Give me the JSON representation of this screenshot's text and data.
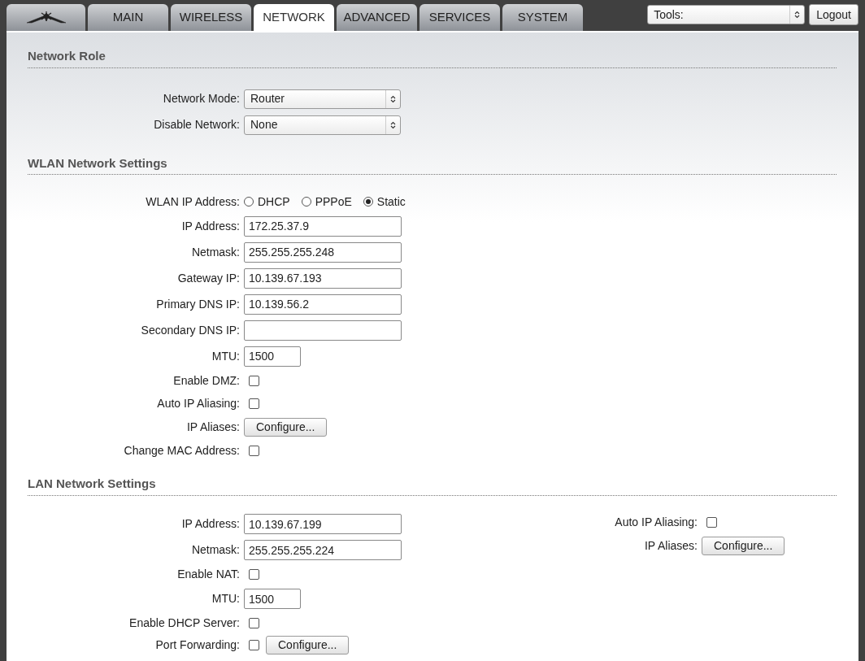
{
  "tabs": [
    {
      "kind": "logo",
      "selected": false
    },
    {
      "kind": "text",
      "label": "MAIN",
      "selected": false
    },
    {
      "kind": "text",
      "label": "WIRELESS",
      "selected": false
    },
    {
      "kind": "text",
      "label": "NETWORK",
      "selected": true
    },
    {
      "kind": "text",
      "label": "ADVANCED",
      "selected": false
    },
    {
      "kind": "text",
      "label": "SERVICES",
      "selected": false
    },
    {
      "kind": "text",
      "label": "SYSTEM",
      "selected": false
    }
  ],
  "tools_select": {
    "value": "Tools:"
  },
  "logout_button": "Logout",
  "sections": [
    {
      "title": "Network Role",
      "rows": [
        {
          "kind": "select",
          "label": "Network Mode:",
          "value": "Router"
        },
        {
          "kind": "select",
          "label": "Disable Network:",
          "value": "None"
        }
      ]
    },
    {
      "title": "WLAN Network Settings",
      "rows": [
        {
          "kind": "radio",
          "label": "WLAN IP Address:",
          "options": [
            {
              "label": "DHCP",
              "selected": false
            },
            {
              "label": "PPPoE",
              "selected": false
            },
            {
              "label": "Static",
              "selected": true
            }
          ]
        },
        {
          "kind": "text",
          "label": "IP Address:",
          "value": "172.25.37.9"
        },
        {
          "kind": "text",
          "label": "Netmask:",
          "value": "255.255.255.248"
        },
        {
          "kind": "text",
          "label": "Gateway IP:",
          "value": "10.139.67.193"
        },
        {
          "kind": "text",
          "label": "Primary DNS IP:",
          "value": "10.139.56.2"
        },
        {
          "kind": "text",
          "label": "Secondary DNS IP:"
        },
        {
          "kind": "short",
          "label": "MTU:",
          "value": "1500"
        },
        {
          "kind": "checkbox",
          "label": "Enable DMZ:",
          "checked": false
        },
        {
          "kind": "checkbox",
          "label": "Auto IP Aliasing:",
          "checked": false
        },
        {
          "kind": "button",
          "label": "IP Aliases:",
          "button": "Configure..."
        },
        {
          "kind": "checkbox",
          "label": "Change MAC Address:",
          "checked": false
        }
      ]
    },
    {
      "title": "LAN Network Settings",
      "rows": [
        {
          "kind": "text",
          "label": "IP Address:",
          "value": "10.139.67.199"
        },
        {
          "kind": "text",
          "label": "Netmask:",
          "value": "255.255.255.224"
        },
        {
          "kind": "checkbox",
          "label": "Enable NAT:",
          "checked": false
        },
        {
          "kind": "short",
          "label": "MTU:",
          "value": "1500"
        },
        {
          "kind": "checkbox",
          "label": "Enable DHCP Server:",
          "checked": false
        },
        {
          "kind": "checkbox_button",
          "label": "Port Forwarding:",
          "checked": false,
          "button": "Configure..."
        }
      ],
      "side_rows": [
        {
          "kind": "checkbox",
          "label": "Auto IP Aliasing:",
          "checked": false
        },
        {
          "kind": "button",
          "label": "IP Aliases:",
          "button": "Configure..."
        }
      ]
    }
  ]
}
